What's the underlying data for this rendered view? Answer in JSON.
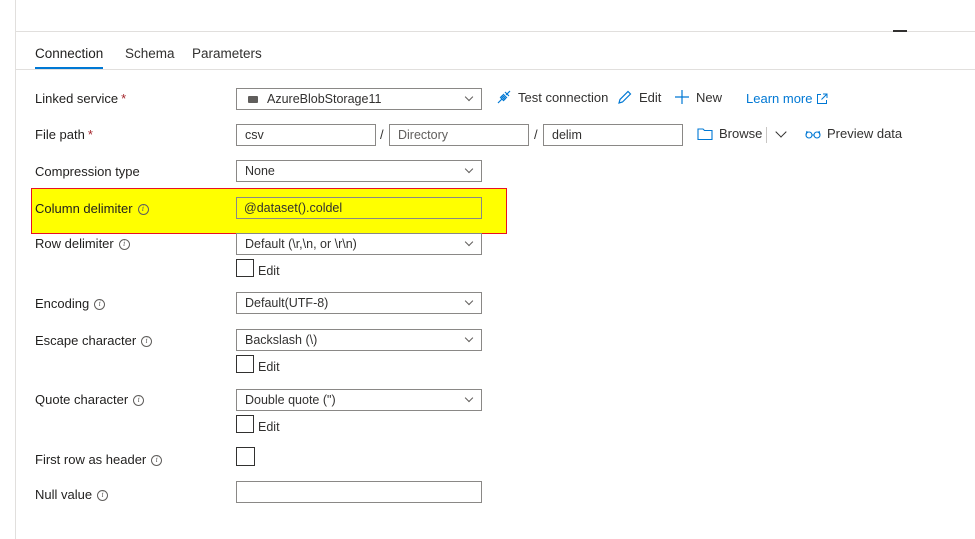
{
  "tabs": [
    {
      "label": "Connection",
      "active": true
    },
    {
      "label": "Schema",
      "active": false
    },
    {
      "label": "Parameters",
      "active": false
    }
  ],
  "linked_service": {
    "label": "Linked service",
    "required_mark": "*",
    "value": "AzureBlobStorage11",
    "icon": "storage-icon",
    "test_connection": "Test connection",
    "edit": "Edit",
    "new": "New",
    "learn_more": "Learn more"
  },
  "file_path": {
    "label": "File path",
    "required_mark": "*",
    "container": "csv",
    "directory_placeholder": "Directory",
    "file": "delim",
    "separator": "/",
    "browse": "Browse",
    "preview": "Preview data"
  },
  "compression_type": {
    "label": "Compression type",
    "value": "None"
  },
  "column_delimiter": {
    "label": "Column delimiter",
    "value": "@dataset().coldel"
  },
  "row_delimiter": {
    "label": "Row delimiter",
    "value": "Default (\\r,\\n, or \\r\\n)",
    "edit_label": "Edit"
  },
  "encoding": {
    "label": "Encoding",
    "value": "Default(UTF-8)"
  },
  "escape_character": {
    "label": "Escape character",
    "value": "Backslash (\\)",
    "edit_label": "Edit"
  },
  "quote_character": {
    "label": "Quote character",
    "value": "Double quote (\")",
    "edit_label": "Edit"
  },
  "first_row_header": {
    "label": "First row as header",
    "checked": false
  },
  "null_value": {
    "label": "Null value",
    "value": ""
  },
  "colors": {
    "accent": "#0078d4",
    "highlight": "#ffff00",
    "highlight_border": "#e81123",
    "required": "#a4262c"
  }
}
